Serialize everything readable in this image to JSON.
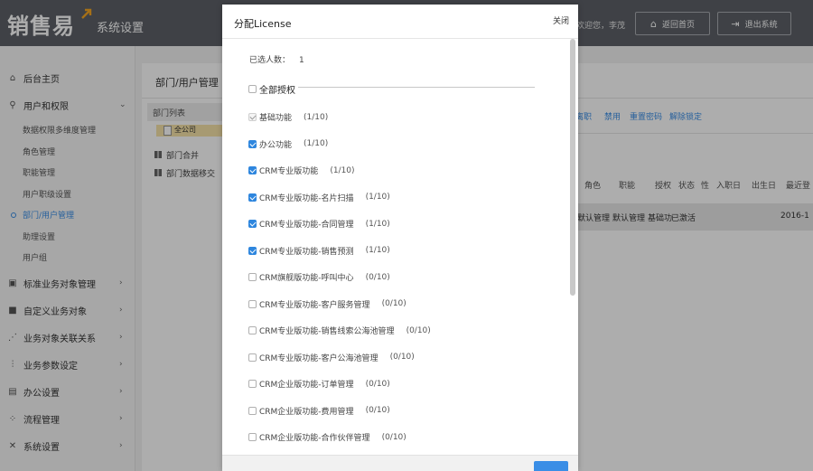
{
  "header": {
    "logo": "销售易",
    "page_name": "系统设置",
    "welcome": "欢迎您，李茂",
    "home_button": "返回首页",
    "exit_button": "退出系统",
    "colors": {
      "header_bg": "#5d6168",
      "accent": "#3a8ee6"
    }
  },
  "sidebar": {
    "home": "后台主页",
    "users": "用户和权限",
    "sub_items": [
      "数据权限多维度管理",
      "角色管理",
      "职能管理",
      "用户职级设置",
      "部门/用户管理",
      "助理设置",
      "用户组"
    ],
    "sections": [
      "标准业务对象管理",
      "自定义业务对象",
      "业务对象关联关系",
      "业务参数设定",
      "办公设置",
      "流程管理",
      "系统设置"
    ]
  },
  "main": {
    "title": "部门/用户管理",
    "dept_list": "部门列表",
    "dept_root": "全公司",
    "links": [
      "部门合并",
      "部门数据移交"
    ],
    "toolbar": [
      "离职",
      "禁用",
      "重置密码",
      "解除锁定"
    ],
    "columns": [
      "角色",
      "职能",
      "授权",
      "状态",
      "性",
      "入职日",
      "出生日",
      "最近登"
    ],
    "row": {
      "roles": "默认管理",
      "function": "默认管理",
      "auth": "基础功",
      "status": "已激活",
      "date": "2016-1"
    }
  },
  "modal": {
    "title": "分配License",
    "close": "关闭",
    "selected_label": "已选人数：",
    "selected_count": "1",
    "select_all": "全部授权",
    "licenses": [
      {
        "name": "基础功能",
        "count": "(1/10)",
        "state": "disabled"
      },
      {
        "name": "办公功能",
        "count": "(1/10)",
        "state": "checked"
      },
      {
        "name": "CRM专业版功能",
        "count": "(1/10)",
        "state": "checked"
      },
      {
        "name": "CRM专业版功能-名片扫描",
        "count": "(1/10)",
        "state": "checked"
      },
      {
        "name": "CRM专业版功能-合同管理",
        "count": "(1/10)",
        "state": "checked"
      },
      {
        "name": "CRM专业版功能-销售预测",
        "count": "(1/10)",
        "state": "checked"
      },
      {
        "name": "CRM旗舰版功能-呼叫中心",
        "count": "(0/10)",
        "state": "unchecked"
      },
      {
        "name": "CRM专业版功能-客户服务管理",
        "count": "(0/10)",
        "state": "unchecked"
      },
      {
        "name": "CRM专业版功能-销售线索公海池管理",
        "count": "(0/10)",
        "state": "unchecked"
      },
      {
        "name": "CRM专业版功能-客户公海池管理",
        "count": "(0/10)",
        "state": "unchecked"
      },
      {
        "name": "CRM企业版功能-订单管理",
        "count": "(0/10)",
        "state": "unchecked"
      },
      {
        "name": "CRM企业版功能-费用管理",
        "count": "(0/10)",
        "state": "unchecked"
      },
      {
        "name": "CRM企业版功能-合作伙伴管理",
        "count": "(0/10)",
        "state": "unchecked"
      }
    ]
  }
}
